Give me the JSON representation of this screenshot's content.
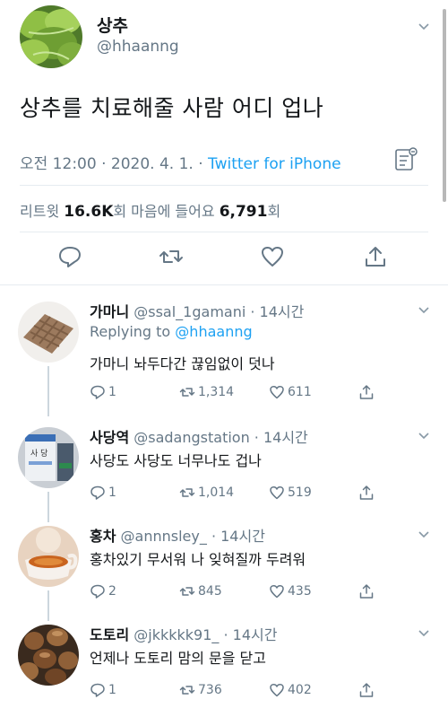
{
  "tweet": {
    "name": "상추",
    "handle": "@hhaanng",
    "text": "상추를 치료해줄 사람 어디 업나",
    "time": "오전 12:00 · 2020. 4. 1. · ",
    "source": "Twitter for iPhone",
    "retweets_label": "리트윗 ",
    "retweets": "16.6K",
    "retweets_suffix": "회  마음에 들어요 ",
    "likes": "6,791",
    "likes_suffix": "회"
  },
  "replies": [
    {
      "name": "가마니",
      "handle": " @ssal_1gamani · 14시간",
      "replying_prefix": "Replying to ",
      "replying_to": "@hhaanng",
      "text": "가마니 놔두다간 끊임없이 덧나",
      "replies": "1",
      "retweets": "1,314",
      "likes": "611"
    },
    {
      "name": "사당역",
      "handle": " @sadangstation · 14시간",
      "text": "사당도 사당도 너무나도 겁나",
      "replies": "1",
      "retweets": "1,014",
      "likes": "519"
    },
    {
      "name": "홍차",
      "handle": " @annnsley_ · 14시간",
      "text": "홍차있기 무서워 나 잊혀질까 두려워",
      "replies": "2",
      "retweets": "845",
      "likes": "435"
    },
    {
      "name": "도토리",
      "handle": " @jkkkkk91_ · 14시간",
      "text": "언제나 도토리 맘의 문을 닫고",
      "replies": "1",
      "retweets": "736",
      "likes": "402"
    }
  ],
  "icons": {
    "reply": "reply-icon",
    "retweet": "retweet-icon",
    "like": "heart-icon",
    "share": "share-icon",
    "analytics": "analytics-icon",
    "more": "chevron-down-icon"
  },
  "colors": {
    "link": "#1da1f2",
    "muted": "#657786",
    "text": "#14171a"
  }
}
